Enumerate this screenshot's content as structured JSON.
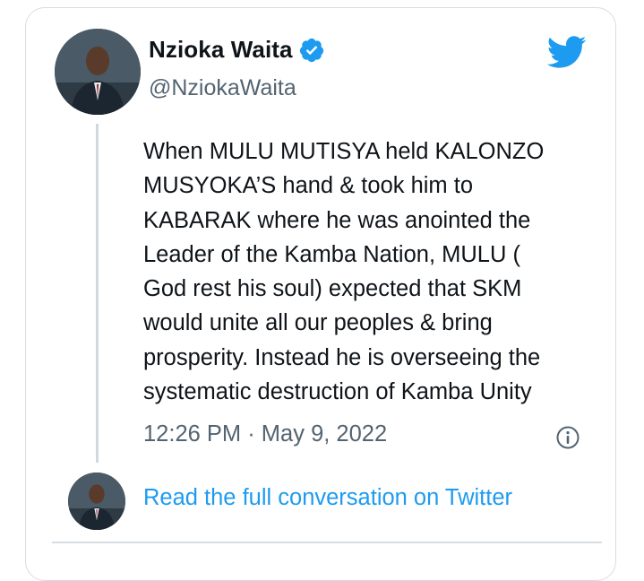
{
  "author": {
    "name": "Nzioka Waita",
    "handle": "@NziokaWaita",
    "verified": true,
    "avatar_icon": "profile-photo"
  },
  "brand": {
    "icon": "twitter-bird-icon",
    "color": "#1d9bf0"
  },
  "tweet": {
    "text": "When MULU MUTISYA held KALONZO\nMUSYOKA’S hand & took him to\nKABARAK where he was anointed the\nLeader of the Kamba Nation, MULU (\nGod rest his soul) expected that SKM\nwould unite all our peoples & bring\nprosperity. Instead he is overseeing the\nsystematic destruction of Kamba Unity",
    "timestamp": "12:26 PM · May 9, 2022"
  },
  "footer": {
    "link_label": "Read the full conversation on Twitter"
  },
  "colors": {
    "text": "#0f1419",
    "secondary": "#536471",
    "link": "#1d9bf0",
    "border": "#d6dde2"
  }
}
